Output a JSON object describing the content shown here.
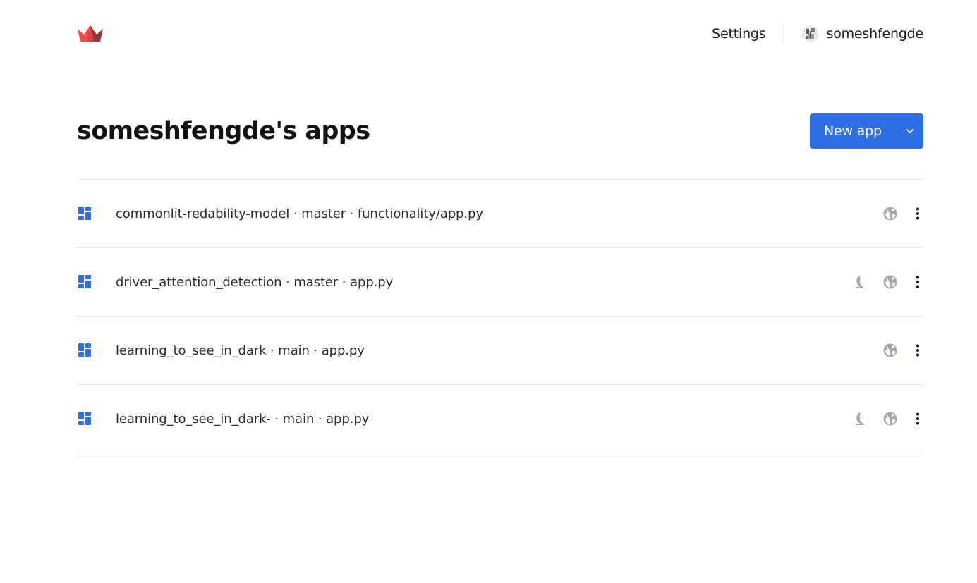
{
  "nav": {
    "settings_label": "Settings",
    "username": "someshfengde"
  },
  "header": {
    "title": "someshfengde's apps",
    "new_app_label": "New app"
  },
  "apps": [
    {
      "label": "commonlit-redability-model · master · functionality/app.py",
      "sleeping": false
    },
    {
      "label": "driver_attention_detection · master · app.py",
      "sleeping": true
    },
    {
      "label": "learning_to_see_in_dark · main · app.py",
      "sleeping": false
    },
    {
      "label": "learning_to_see_in_dark- · main · app.py",
      "sleeping": true
    }
  ],
  "colors": {
    "accent": "#2e6fe6",
    "logo_primary": "#ff4b4b",
    "icon_muted": "#a3a8b4",
    "divider": "#e6e7eb"
  },
  "icons": {
    "logo": "streamlit-crown-logo",
    "app": "dashboard-grid-icon",
    "sleep": "moon-icon",
    "public": "globe-icon",
    "menu": "more-vertical-icon",
    "dropdown": "chevron-down-icon"
  }
}
